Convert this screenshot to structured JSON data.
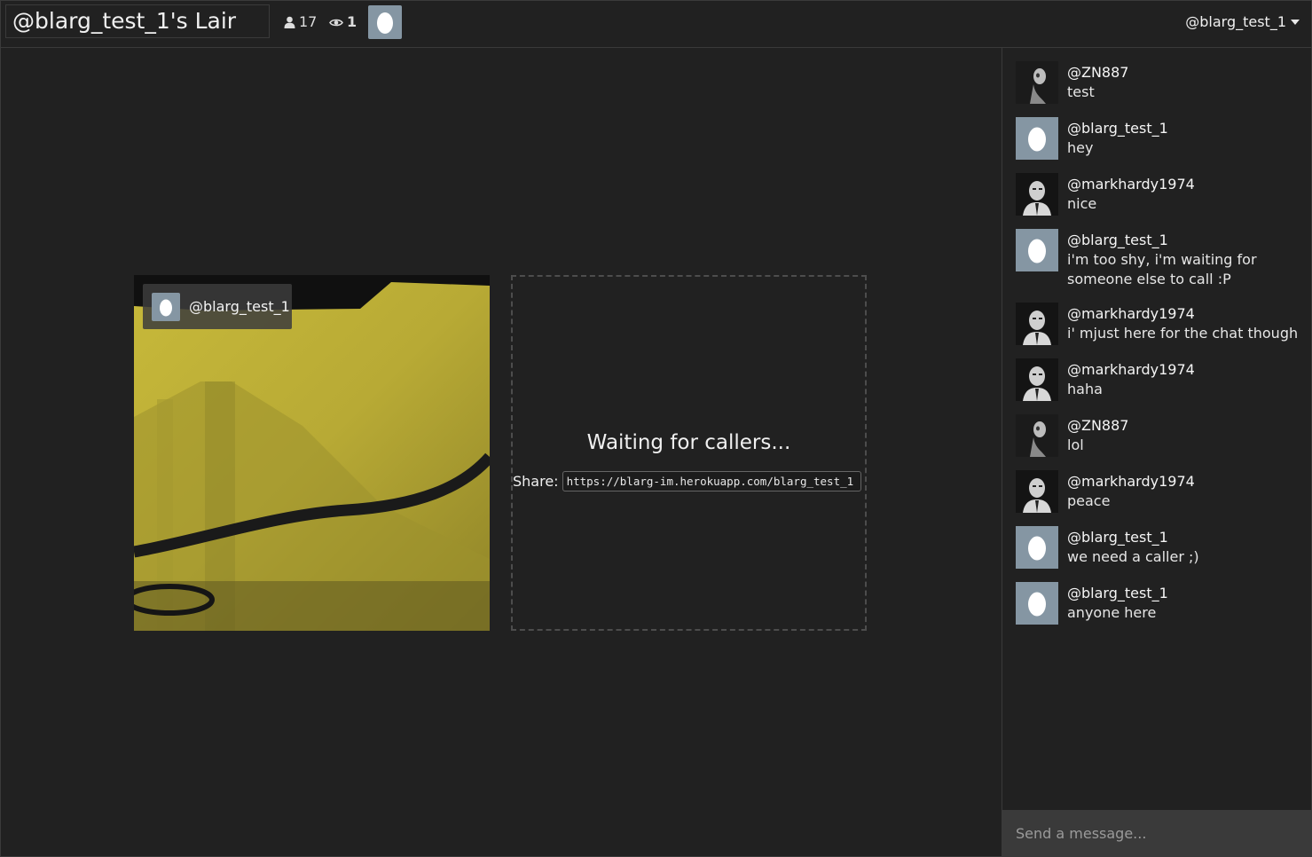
{
  "header": {
    "room_title": "@blarg_test_1's Lair",
    "user_count": "17",
    "viewer_count": "1",
    "user_menu_label": "@blarg_test_1",
    "user_icon": "user-icon",
    "eye_icon": "eye-icon"
  },
  "stage": {
    "local_video": {
      "name": "@blarg_test_1"
    },
    "waiting": {
      "text": "Waiting for callers...",
      "share_label": "Share:",
      "share_url": "https://blarg-im.herokuapp.com/blarg_test_1"
    }
  },
  "chat": {
    "input_placeholder": "Send a message...",
    "messages": [
      {
        "author": "@ZN887",
        "text": "test",
        "avatar": "skull-photo"
      },
      {
        "author": "@blarg_test_1",
        "text": "hey",
        "avatar": "egg"
      },
      {
        "author": "@markhardy1974",
        "text": "nice",
        "avatar": "face-photo"
      },
      {
        "author": "@blarg_test_1",
        "text": "i'm too shy, i'm waiting for someone else to call :P",
        "avatar": "egg"
      },
      {
        "author": "@markhardy1974",
        "text": "i' mjust here for the chat though",
        "avatar": "face-photo"
      },
      {
        "author": "@markhardy1974",
        "text": "haha",
        "avatar": "face-photo"
      },
      {
        "author": "@ZN887",
        "text": "lol",
        "avatar": "skull-photo"
      },
      {
        "author": "@markhardy1974",
        "text": "peace",
        "avatar": "face-photo"
      },
      {
        "author": "@blarg_test_1",
        "text": "we need a caller ;)",
        "avatar": "egg"
      },
      {
        "author": "@blarg_test_1",
        "text": "anyone here",
        "avatar": "egg"
      }
    ]
  },
  "colors": {
    "background": "#212121",
    "border": "#3a3a3a",
    "egg_avatar_bg": "#8596a3",
    "input_bg": "#3a3a3a"
  }
}
